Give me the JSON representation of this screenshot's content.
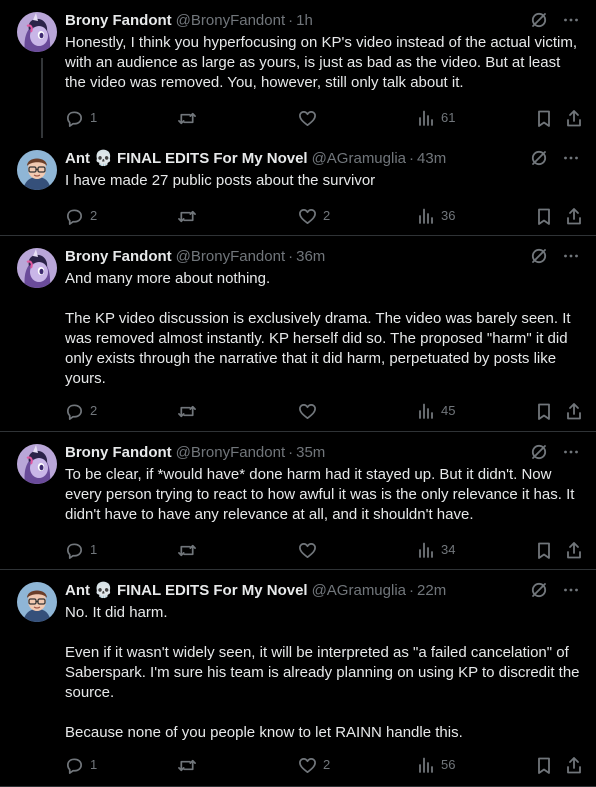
{
  "posts": [
    {
      "name": "Brony Fandont",
      "handle": "@BronyFandont",
      "time": "1h",
      "avatar": "brony",
      "body": "Honestly, I think you hyperfocusing on KP's video instead of the actual victim, with an audience as large as yours, is just as bad as the video. But at least the video was removed. You, however, still only talk about it.",
      "replies": "1",
      "reposts": "",
      "likes": "",
      "views": "61"
    },
    {
      "name": "Ant 💀 FINAL EDITS For My Novel",
      "handle": "@AGramuglia",
      "time": "43m",
      "avatar": "ant",
      "body": "I have made 27 public posts about the survivor",
      "replies": "2",
      "reposts": "",
      "likes": "2",
      "views": "36"
    },
    {
      "name": "Brony Fandont",
      "handle": "@BronyFandont",
      "time": "36m",
      "avatar": "brony",
      "body": "And many more about nothing.\n\nThe KP video discussion is exclusively drama. The video was barely seen. It was removed almost instantly. KP herself did so. The proposed \"harm\" it did only exists through the narrative that it did harm, perpetuated by posts like yours.",
      "replies": "2",
      "reposts": "",
      "likes": "",
      "views": "45"
    },
    {
      "name": "Brony Fandont",
      "handle": "@BronyFandont",
      "time": "35m",
      "avatar": "brony",
      "body": "To be clear, if *would have* done harm had it stayed up. But it didn't. Now every person trying to react to how awful it was is the only relevance it has. It didn't have to have any relevance at all, and it shouldn't have.",
      "replies": "1",
      "reposts": "",
      "likes": "",
      "views": "34"
    },
    {
      "name": "Ant 💀 FINAL EDITS For My Novel",
      "handle": "@AGramuglia",
      "time": "22m",
      "avatar": "ant",
      "body": "No. It did harm.\n\nEven if it wasn't widely seen, it will be interpreted as \"a failed cancelation\" of Saberspark. I'm sure his team is already planning on using KP to discredit the source.\n\nBecause none of you people know to let RAINN handle this.",
      "replies": "1",
      "reposts": "",
      "likes": "2",
      "views": "56"
    }
  ],
  "ui": {
    "dot": "·",
    "icons": [
      "grok-icon",
      "more-icon",
      "reply-icon",
      "repost-icon",
      "like-icon",
      "views-icon",
      "bookmark-icon",
      "share-icon"
    ]
  }
}
